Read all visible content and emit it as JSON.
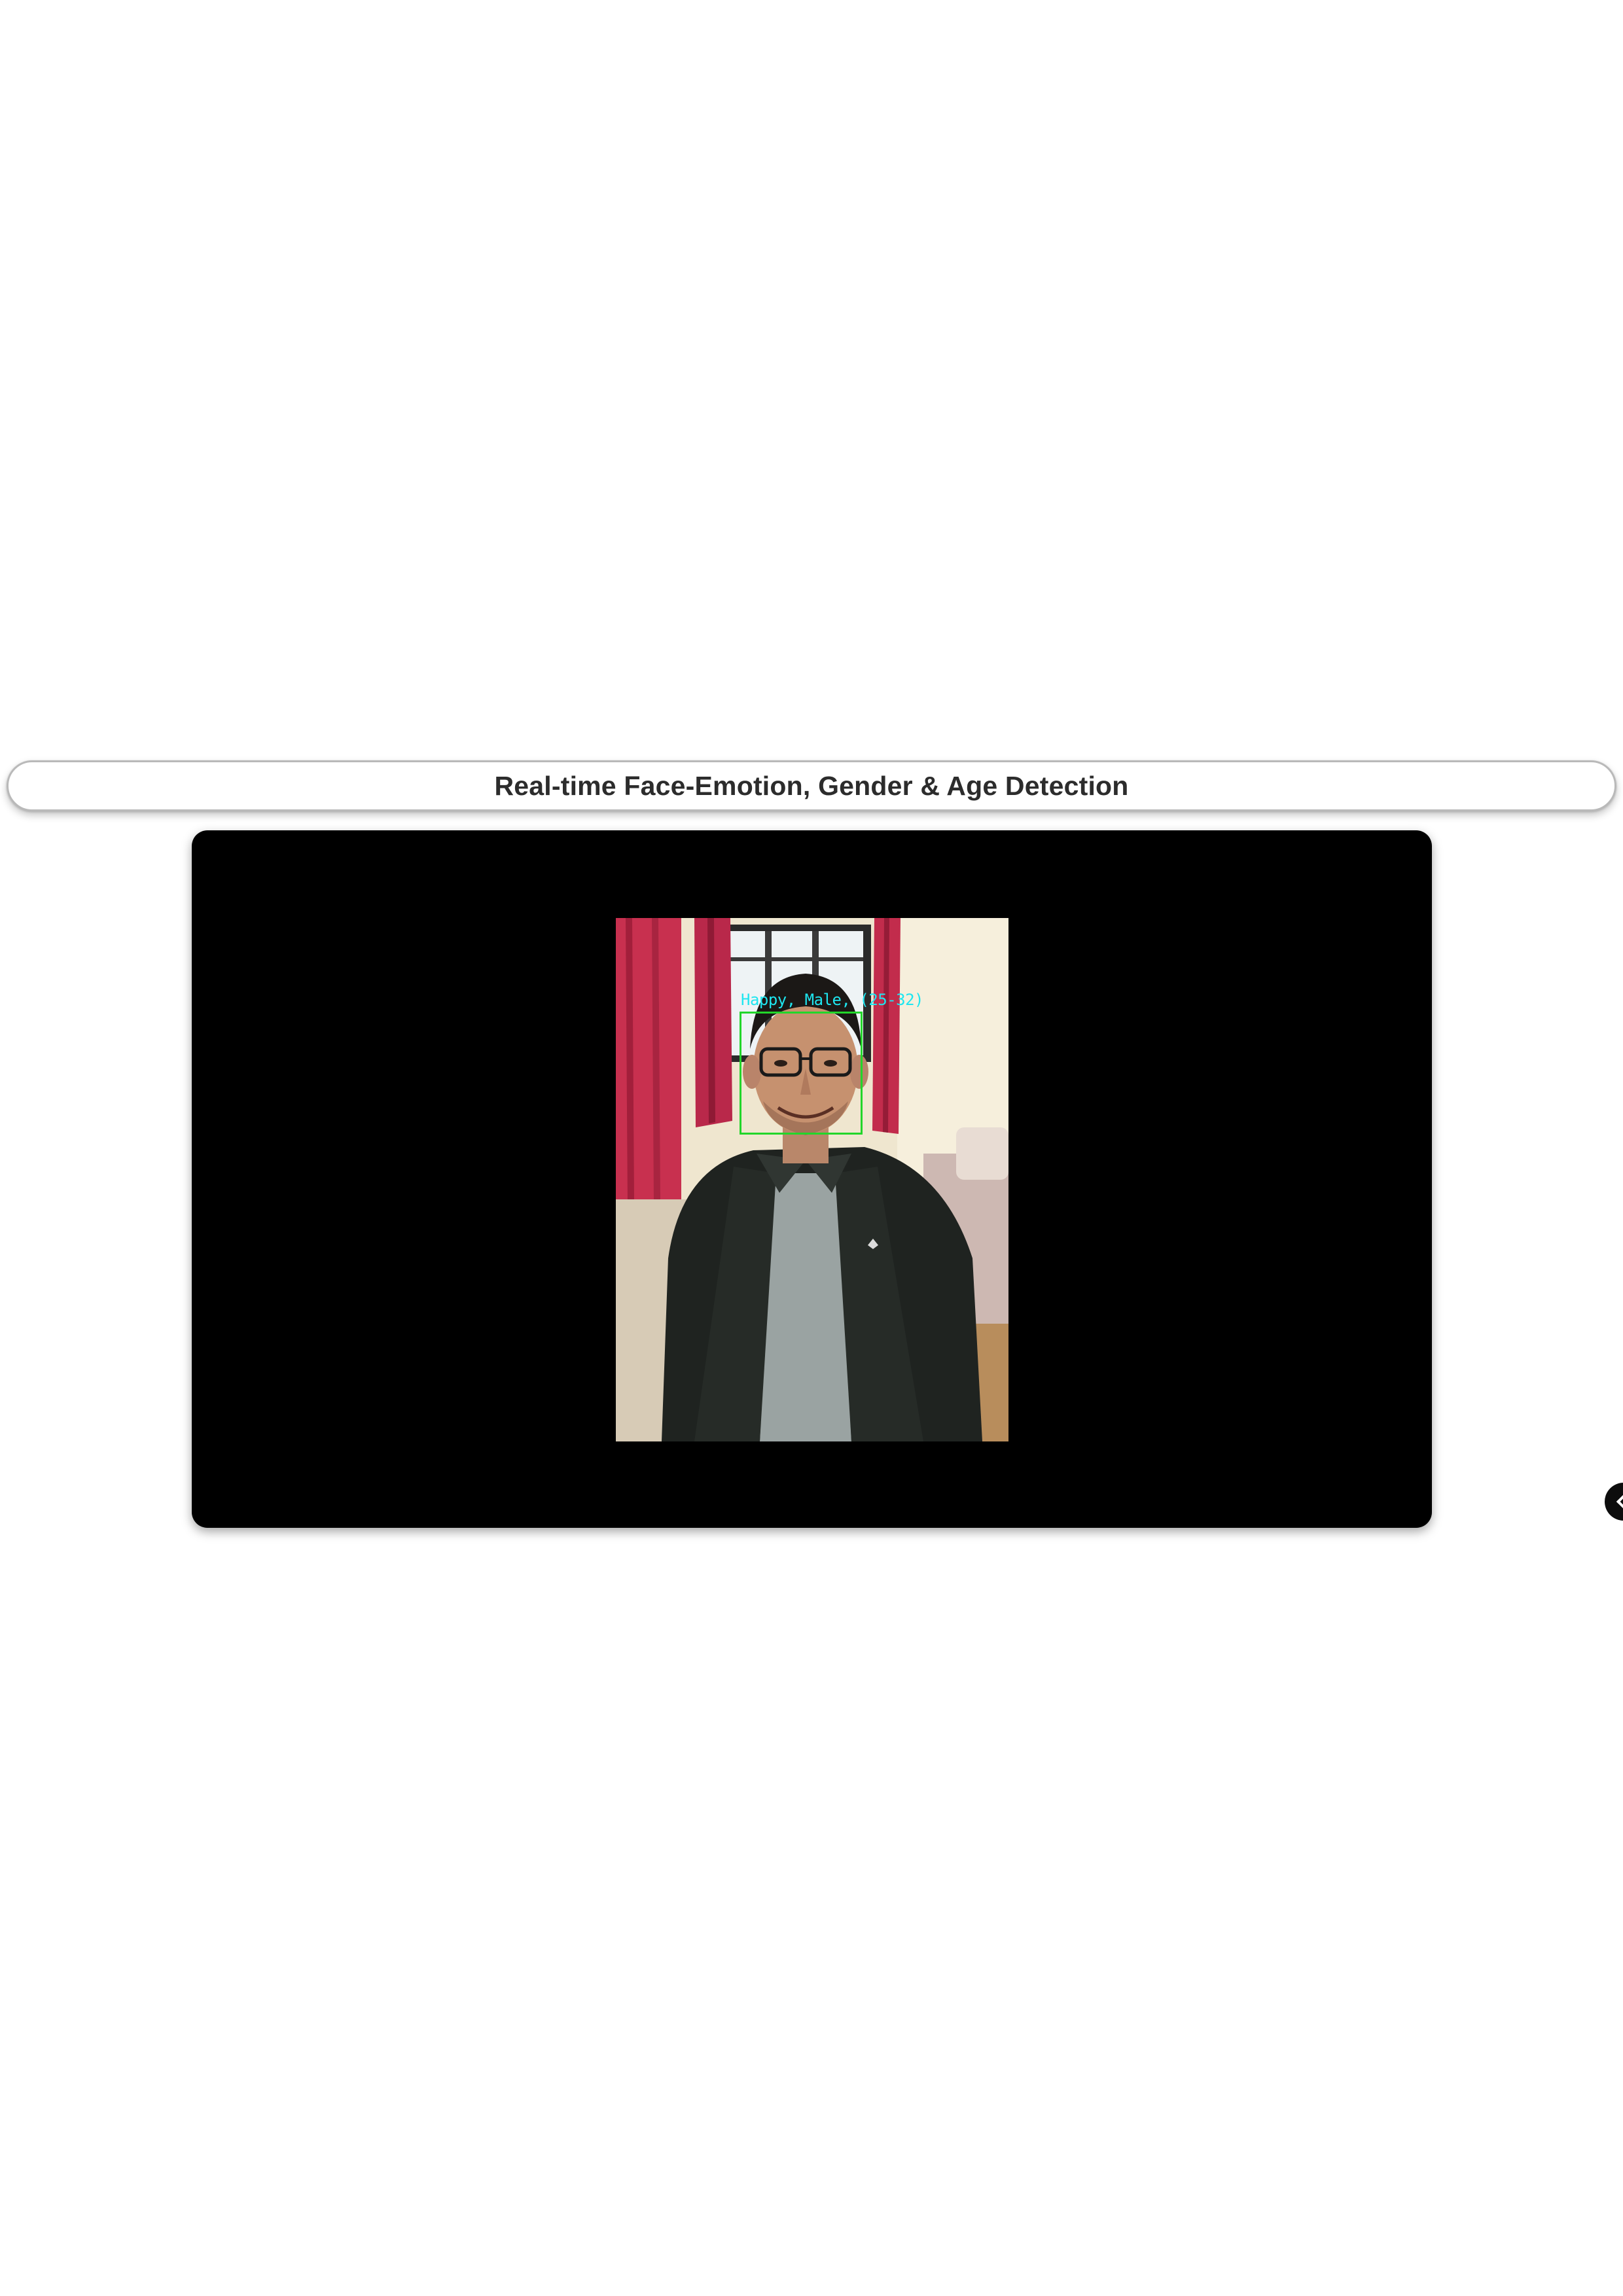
{
  "header": {
    "title": "Real-time Face-Emotion, Gender & Age Detection"
  },
  "video": {
    "detection_label": "Happy, Male, (25-32)"
  },
  "colors": {
    "background": "#ffffff",
    "panel": "#000000",
    "label": "#1ee6f0",
    "box": "#22d62a",
    "title": "#2c2c2c"
  },
  "icons": {
    "side_toggle": "chevron-left-icon"
  }
}
